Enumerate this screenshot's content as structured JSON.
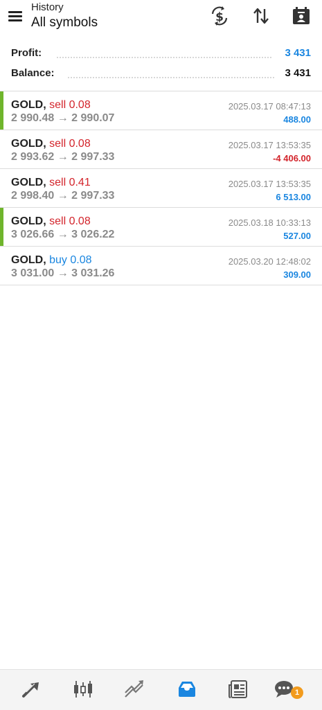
{
  "header": {
    "subtitle": "History",
    "title": "All symbols"
  },
  "summary": {
    "profit_label": "Profit:",
    "profit_value": "3 431",
    "balance_label": "Balance:",
    "balance_value": "3 431"
  },
  "colors": {
    "accent_blue": "#1a86e0",
    "sell_red": "#d3242b",
    "highlight_green": "#6fb52c",
    "badge_orange": "#f29b1d"
  },
  "trades": [
    {
      "symbol": "GOLD,",
      "side": "sell 0.08",
      "prices": "2 990.48 → 2 990.07",
      "time": "2025.03.17 08:47:13",
      "profit": "488.00",
      "highlight": true
    },
    {
      "symbol": "GOLD,",
      "side": "sell 0.08",
      "prices": "2 993.62 → 2 997.33",
      "time": "2025.03.17 13:53:35",
      "profit": "-4 406.00",
      "highlight": false
    },
    {
      "symbol": "GOLD,",
      "side": "sell 0.41",
      "prices": "2 998.40 → 2 997.33",
      "time": "2025.03.17 13:53:35",
      "profit": "6 513.00",
      "highlight": false
    },
    {
      "symbol": "GOLD,",
      "side": "sell 0.08",
      "prices": "3 026.66 → 3 026.22",
      "time": "2025.03.18 10:33:13",
      "profit": "527.00",
      "highlight": true
    },
    {
      "symbol": "GOLD,",
      "side": "buy 0.08",
      "prices": "3 031.00 → 3 031.26",
      "time": "2025.03.20 12:48:02",
      "profit": "309.00",
      "highlight": false
    }
  ],
  "icons": {
    "header": [
      "menu-icon",
      "deposit-withdraw-icon",
      "sort-icon",
      "calendar-icon"
    ],
    "bottom_nav": [
      "quotes-icon",
      "chart-icon",
      "trade-icon",
      "history-icon",
      "news-icon",
      "messages-icon"
    ]
  },
  "bottom_nav": {
    "active": "history",
    "messages_badge": "1"
  }
}
